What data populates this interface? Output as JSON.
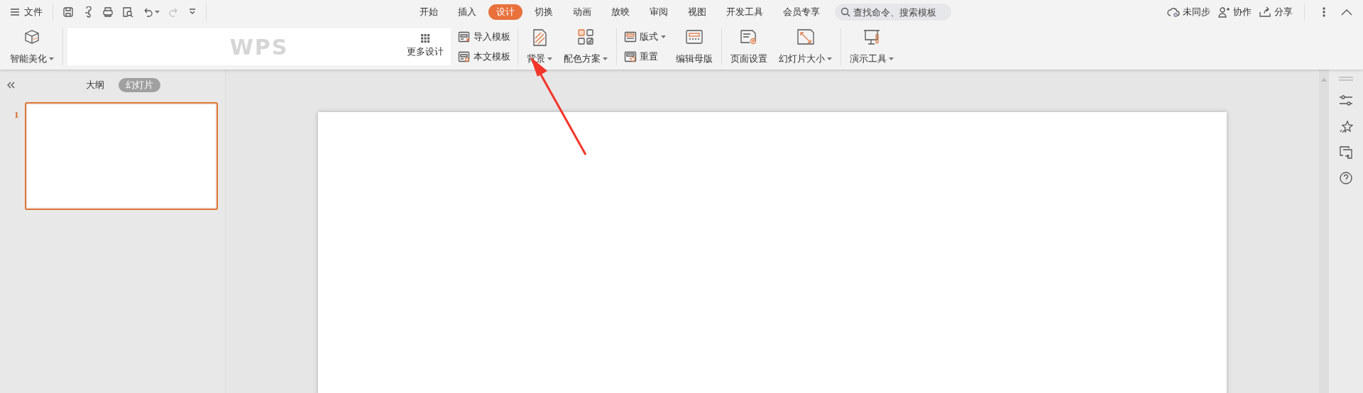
{
  "menu": {
    "label": "文件"
  },
  "quick_access": [
    {
      "kind": "save",
      "disabled": false,
      "dropdown": false
    },
    {
      "kind": "painter",
      "disabled": false,
      "dropdown": false
    },
    {
      "kind": "print",
      "disabled": false,
      "dropdown": false
    },
    {
      "kind": "preview",
      "disabled": false,
      "dropdown": false
    },
    {
      "kind": "undo",
      "disabled": false,
      "dropdown": true
    },
    {
      "kind": "redo",
      "disabled": true,
      "dropdown": false
    },
    {
      "kind": "customize",
      "disabled": false,
      "dropdown": false
    }
  ],
  "tabs": [
    {
      "label": "开始",
      "selected": false
    },
    {
      "label": "插入",
      "selected": false
    },
    {
      "label": "设计",
      "selected": true
    },
    {
      "label": "切换",
      "selected": false
    },
    {
      "label": "动画",
      "selected": false
    },
    {
      "label": "放映",
      "selected": false
    },
    {
      "label": "审阅",
      "selected": false
    },
    {
      "label": "视图",
      "selected": false
    },
    {
      "label": "开发工具",
      "selected": false
    },
    {
      "label": "会员专享",
      "selected": false
    }
  ],
  "search": {
    "placeholder": "查找命令、搜索模板"
  },
  "top_right": [
    {
      "kind": "cloud",
      "label": "未同步"
    },
    {
      "kind": "person",
      "label": "协作"
    },
    {
      "kind": "share",
      "label": "分享"
    }
  ],
  "ribbon": {
    "groups": [
      {
        "items": [
          {
            "kind": "large",
            "label": "智能美化",
            "dropdown": true
          }
        ]
      },
      {
        "items": [
          {
            "kind": "gallery",
            "logo": "WPS",
            "more": "更多设计"
          }
        ]
      },
      {
        "items": [
          {
            "kind": "stack",
            "items": [
              {
                "label": "导入模板",
                "dropdown": false
              },
              {
                "label": "本文模板",
                "dropdown": false
              }
            ]
          }
        ]
      },
      {
        "items": [
          {
            "kind": "large",
            "label": "背景",
            "dropdown": true
          },
          {
            "kind": "large",
            "label": "配色方案",
            "dropdown": true
          }
        ]
      },
      {
        "items": [
          {
            "kind": "stack",
            "items": [
              {
                "label": "版式",
                "dropdown": true
              },
              {
                "label": "重置",
                "dropdown": false
              }
            ]
          },
          {
            "kind": "large",
            "label": "编辑母版",
            "dropdown": false
          }
        ]
      },
      {
        "items": [
          {
            "kind": "large",
            "label": "页面设置",
            "dropdown": false
          },
          {
            "kind": "large",
            "label": "幻灯片大小",
            "dropdown": true
          }
        ]
      },
      {
        "items": [
          {
            "kind": "large",
            "label": "演示工具",
            "dropdown": true
          }
        ]
      }
    ]
  },
  "panel": {
    "views": [
      {
        "label": "大纲",
        "selected": false
      },
      {
        "label": "幻灯片",
        "selected": true
      }
    ],
    "slides": [
      {
        "number": "1",
        "selected": true
      }
    ]
  }
}
